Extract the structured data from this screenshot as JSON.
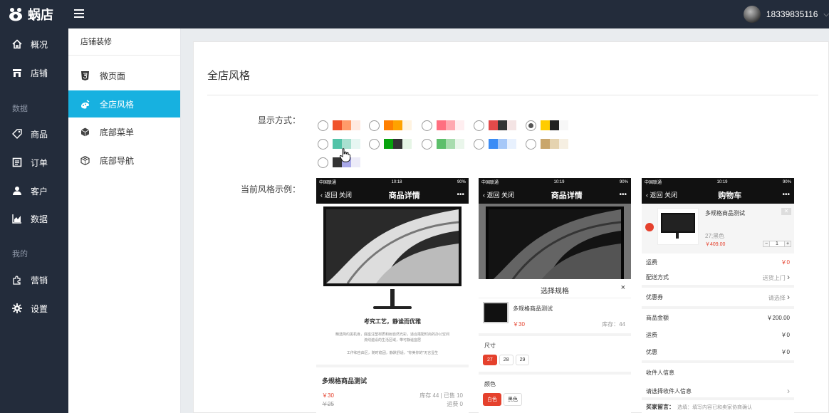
{
  "topbar": {
    "logo": "蜗店",
    "user": "18339835116"
  },
  "nav": [
    {
      "label": "概况",
      "icon": "home-icon"
    },
    {
      "label": "店铺",
      "icon": "store-icon"
    },
    {
      "label": "商品",
      "icon": "tag-icon"
    },
    {
      "label": "订单",
      "icon": "order-icon"
    },
    {
      "label": "客户",
      "icon": "user-icon"
    },
    {
      "label": "数据",
      "icon": "chart-icon"
    },
    {
      "label": "营销",
      "icon": "puzzle-icon"
    },
    {
      "label": "设置",
      "icon": "gear-icon"
    }
  ],
  "nav_groups": [
    "数据",
    "我的"
  ],
  "subnav": {
    "title": "店铺装修",
    "items": [
      {
        "label": "微页面",
        "icon": "html5-icon"
      },
      {
        "label": "全店风格",
        "icon": "palette-icon"
      },
      {
        "label": "底部菜单",
        "icon": "cube-icon"
      },
      {
        "label": "底部导航",
        "icon": "cubes-icon"
      }
    ],
    "active": "全店风格"
  },
  "main": {
    "title": "全店风格",
    "display_label": "显示方式：",
    "example_label": "当前风格示例：",
    "selected_scheme": 4,
    "schemes": [
      [
        "#f0532b",
        "#ff9b6a",
        "#ffe9e0"
      ],
      [
        "#ff7f00",
        "#ffa200",
        "#fff3e0"
      ],
      [
        "#ff6f80",
        "#ffa8b0",
        "#ffeef0"
      ],
      [
        "#e24a4a",
        "#333333",
        "#f4e4e4"
      ],
      [
        "#ffcc00",
        "#222222",
        "#f7f7f7"
      ],
      [
        "#52c3a8",
        "#a8e0d0",
        "#e6f6f2"
      ],
      [
        "#07a30d",
        "#333333",
        "#e6f5e6"
      ],
      [
        "#5dbf6b",
        "#a8dcae",
        "#eaf6eb"
      ],
      [
        "#3b8cf5",
        "#a6c8f8",
        "#e8f1fe"
      ],
      [
        "#c9a66b",
        "#e5d3b0",
        "#f6efe2"
      ],
      [
        "#333333",
        "#a8a8e8",
        "#ecebf8"
      ]
    ]
  },
  "phone1": {
    "carrier": "中国联通",
    "time": "10:18",
    "battery": "90%",
    "back": "返回",
    "close": "关闭",
    "title": "商品详情",
    "more": "•••",
    "slogan": "考究工艺，静谧而优雅",
    "desc_line1": "精选简约黑机身，底座注塑材质和射自然光彩，适合搭配时尚的办公空间",
    "desc_line2": "流线遍设的生活区域，带可静谧宜居",
    "desc_line3": "工作和自由区，随时稳固，静默舒适，\"你美你的\"无言显生",
    "product_name": "多规格商品测试",
    "price": "￥30",
    "old_price": "￥25",
    "stock_line": "库存 44 | 已售 10",
    "freight": "运费 0"
  },
  "phone2": {
    "carrier": "中国联通",
    "time": "10:19",
    "battery": "90%",
    "back": "返回",
    "close": "关闭",
    "title": "商品详情",
    "more": "•••",
    "sheet_title": "选择规格",
    "sheet_close": "×",
    "product_name": "多规格商品测试",
    "price": "￥30",
    "stock": "库存：44",
    "size_label": "尺寸",
    "sizes": [
      "27",
      "28",
      "29"
    ],
    "color_label": "颜色",
    "colors": [
      "白色",
      "黑色"
    ]
  },
  "phone3": {
    "carrier": "中国联通",
    "time": "10:19",
    "battery": "90%",
    "back": "返回",
    "close": "关闭",
    "title": "购物车",
    "more": "•••",
    "product_name": "多规格商品测试",
    "spec": "27;黑色",
    "price": "￥409.00",
    "qty": "1",
    "minus": "−",
    "plus": "+",
    "rows": [
      {
        "label": "运费",
        "value": "￥0",
        "red": true
      },
      {
        "label": "配送方式",
        "value": "送货上门"
      },
      {
        "label": "优惠券",
        "value": "请选择"
      },
      {
        "label": "商品金额",
        "value": "￥200.00"
      },
      {
        "label": "运费",
        "value": "￥0"
      },
      {
        "label": "优惠",
        "value": "￥0"
      }
    ],
    "receiver_title": "收件人信息",
    "receiver_select": "请选择收件人信息",
    "message_label": "买家留言：",
    "message_placeholder": "选填：填写内容已和卖家协商确认"
  }
}
